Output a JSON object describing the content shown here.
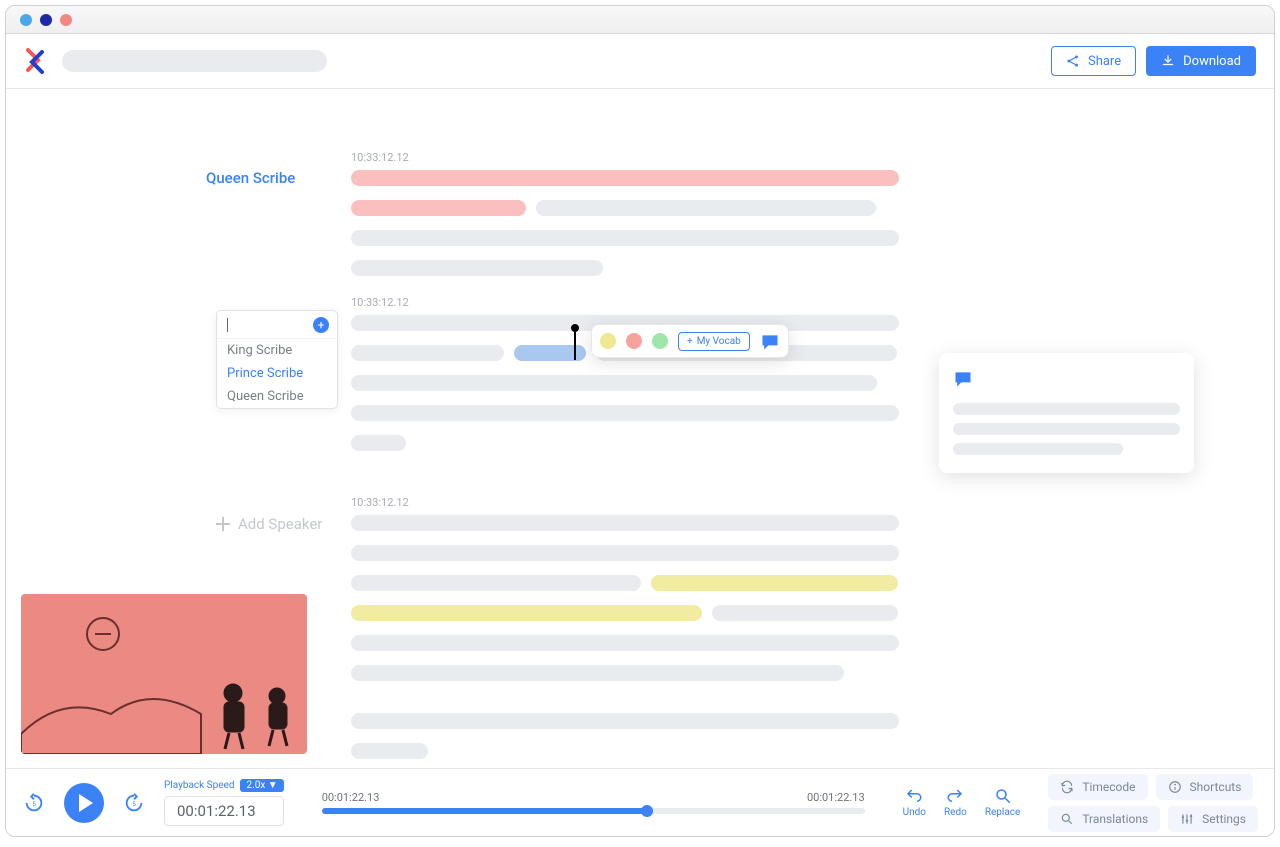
{
  "header": {
    "share_label": "Share",
    "download_label": "Download"
  },
  "transcript": {
    "block1": {
      "timecode": "10:33:12.12",
      "speaker": "Queen Scribe"
    },
    "block2": {
      "timecode": "10:33:12.12"
    },
    "block3": {
      "timecode": "10:33:12.12"
    }
  },
  "speaker_dropdown": {
    "items": [
      "King Scribe",
      "Prince Scribe",
      "Queen Scribe"
    ],
    "selected_index": 1
  },
  "add_speaker_label": "Add Speaker",
  "selection_toolbar": {
    "vocab_label": "My Vocab"
  },
  "footer": {
    "playback_speed_label": "Playback Speed",
    "speed_value": "2.0x",
    "time_box": "00:01:22.13",
    "progress_left": "00:01:22.13",
    "progress_right": "00:01:22.13",
    "undo_label": "Undo",
    "redo_label": "Redo",
    "replace_label": "Replace",
    "timecode_label": "Timecode",
    "shortcuts_label": "Shortcuts",
    "translations_label": "Translations",
    "settings_label": "Settings"
  }
}
